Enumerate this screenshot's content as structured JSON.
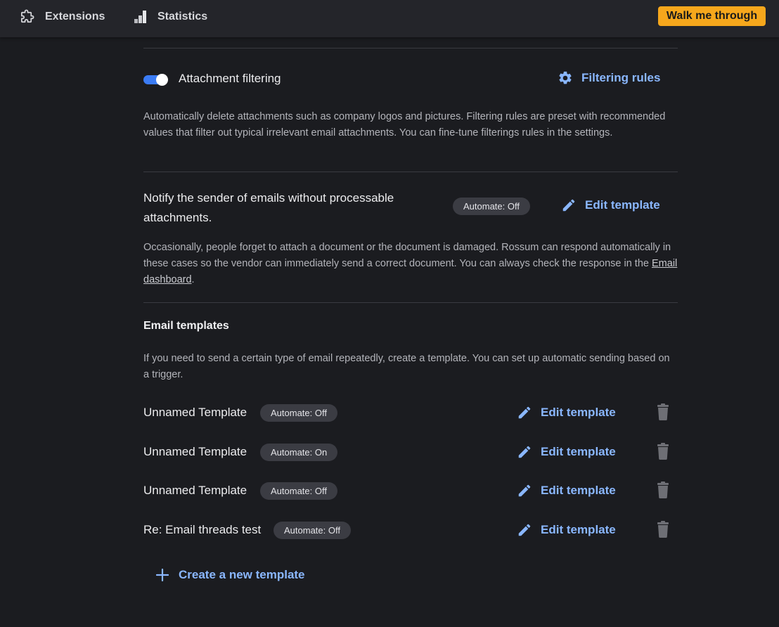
{
  "colors": {
    "background": "#1b1c20",
    "topbar": "#24252a",
    "accent_link": "#8ab7ff",
    "walk_button": "#f6a71c",
    "toggle_on": "#3b7cf5",
    "badge_bg": "#3b3c43"
  },
  "nav": {
    "items": [
      {
        "label": "Extensions",
        "icon": "puzzle-icon"
      },
      {
        "label": "Statistics",
        "icon": "bar-chart-icon"
      }
    ],
    "walk_button": "Walk me through"
  },
  "attachment_filtering": {
    "enabled": true,
    "label": "Attachment filtering",
    "rules_button": "Filtering rules",
    "description": "Automatically delete attachments such as company logos and pictures. Filtering rules are preset with recommended values that filter out typical irrelevant email attachments. You can fine-tune filterings rules in the settings."
  },
  "notify_sender": {
    "title_line1": "Notify the sender of emails without processable",
    "title_line2": "attachments.",
    "badge": "Automate: Off",
    "edit_button": "Edit template",
    "description_before_link": "Occasionally, people forget to attach a document or the document is damaged. Rossum can respond automatically in these cases so the vendor can immediately send a correct document. You can always check the response in the ",
    "link": "Email dashboard",
    "description_after_link": "."
  },
  "email_templates": {
    "title": "Email templates",
    "description": "If you need to send a certain type of email repeatedly, create a template. You can set up automatic sending based on a trigger.",
    "items": [
      {
        "name": "Unnamed Template",
        "badge": "Automate: Off",
        "edit": "Edit template"
      },
      {
        "name": "Unnamed Template",
        "badge": "Automate: On",
        "edit": "Edit template"
      },
      {
        "name": "Unnamed Template",
        "badge": "Automate: Off",
        "edit": "Edit template"
      },
      {
        "name": "Re: Email threads test",
        "badge": "Automate: Off",
        "edit": "Edit template"
      }
    ],
    "create_button": "Create a new template"
  }
}
